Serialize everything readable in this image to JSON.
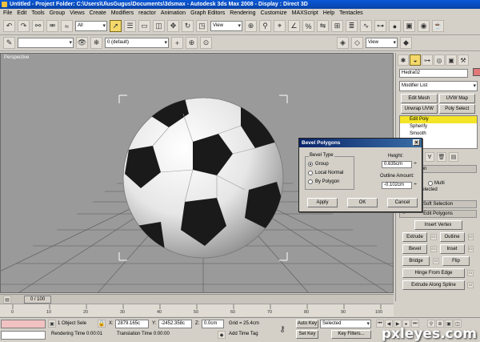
{
  "window": {
    "title": "Untitled    - Project Folder: C:\\Users\\UlusGugus\\Documents\\3dsmax    - Autodesk 3ds Max 2008    - Display : Direct 3D"
  },
  "menu": [
    "File",
    "Edit",
    "Tools",
    "Group",
    "Views",
    "Create",
    "Modifiers",
    "reactor",
    "Animation",
    "Graph Editors",
    "Rendering",
    "Customize",
    "MAXScript",
    "Help",
    "Tentacles"
  ],
  "toolbar": {
    "selection_filter": "All",
    "reference_coord": "View",
    "layer": "0 (default)",
    "view_combo": "View"
  },
  "viewport": {
    "label": "Perspective"
  },
  "command_panel": {
    "object_name": "Hedra02",
    "object_color": "#e07878",
    "modifier_list": "Modifier List",
    "buttons": [
      "Edit Mesh",
      "UVW Map",
      "Unwrap UVW",
      "Poly Select"
    ],
    "stack": [
      "Edit Poly",
      "Spherify",
      "Smooth",
      "oly"
    ],
    "partial_labels": [
      "k Selection",
      "ection",
      "ubObj",
      "Multi",
      "olygons Selected"
    ],
    "rollouts": {
      "soft_selection": "Soft Selection",
      "edit_polygons": "Edit Polygons"
    },
    "edit_polygon_buttons": {
      "insert_vertex": "Insert Vertex",
      "extrude": "Extrude",
      "outline": "Outline",
      "bevel": "Bevel",
      "inset": "Inset",
      "bridge": "Bridge",
      "flip": "Flip",
      "hinge": "Hinge From Edge",
      "extrude_spline": "Extrude Along Spline"
    }
  },
  "dialog": {
    "title": "Bevel Polygons",
    "bevel_type_label": "Bevel Type",
    "options": [
      "Group",
      "Local Normal",
      "By Polygon"
    ],
    "selected_option": "Group",
    "height_label": "Height:",
    "height_value": "0.635cm",
    "outline_label": "Outline Amount:",
    "outline_value": "-0.102cm",
    "buttons": {
      "apply": "Apply",
      "ok": "OK",
      "cancel": "Cancel"
    }
  },
  "timeline": {
    "frame": "0 / 100",
    "ticks": [
      "0",
      "10",
      "20",
      "30",
      "40",
      "50",
      "60",
      "70",
      "80",
      "90",
      "100"
    ]
  },
  "status": {
    "selection": "1 Object Sele",
    "x_label": "X:",
    "x_value": "2879.165c",
    "y_label": "Y:",
    "y_value": "-2452.358c",
    "z_label": "Z:",
    "z_value": "0.0cm",
    "grid": "Grid = 25.4cm",
    "rendering_time": "Rendering Time  0:00:01",
    "translation_time": "Translation Time  0:00:00",
    "add_time_tag": "Add Time Tag",
    "auto_key": "Auto Key",
    "selected": "Selected",
    "set_key": "Set Key",
    "key_filters": "Key Filters..."
  },
  "watermark": "pxleyes.com"
}
